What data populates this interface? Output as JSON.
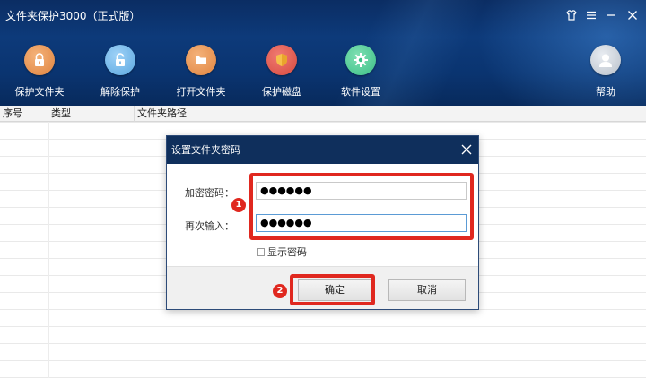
{
  "window": {
    "title": "文件夹保护3000（正式版）",
    "controls": [
      {
        "name": "skin-icon"
      },
      {
        "name": "menu-icon"
      },
      {
        "name": "minimize-icon"
      },
      {
        "name": "close-icon"
      }
    ]
  },
  "toolbar": {
    "protect_folder": "保护文件夹",
    "unprotect": "解除保护",
    "open_folder": "打开文件夹",
    "protect_disk": "保护磁盘",
    "settings": "软件设置",
    "help": "帮助"
  },
  "table": {
    "columns": [
      "序号",
      "类型",
      "文件夹路径"
    ],
    "rows": []
  },
  "dialog": {
    "title": "设置文件夹密码",
    "password_label": "加密密码：",
    "password_value": "●●●●●●",
    "confirm_label": "再次输入：",
    "confirm_value": "●●●●●●",
    "show_password_label": "显示密码",
    "show_password_checked": false,
    "ok_label": "确定",
    "cancel_label": "取消"
  },
  "annotations": {
    "badge_1": "1",
    "badge_2": "2",
    "highlight_color": "#e0281f"
  },
  "colors": {
    "header_bg": "#0d3a7a",
    "dialog_title_bg": "#0f2f5c",
    "input_focus": "#5b9bd5"
  }
}
